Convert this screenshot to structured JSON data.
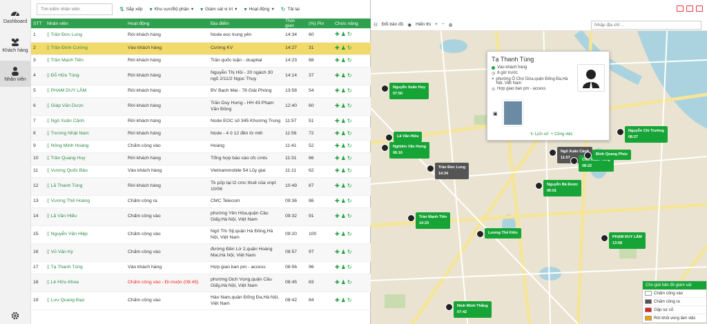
{
  "sidebar": {
    "items": [
      {
        "label": "Dashboard",
        "icon": "dashboard-icon"
      },
      {
        "label": "Khách hàng",
        "icon": "users-icon"
      },
      {
        "label": "Nhân viên",
        "icon": "user-icon"
      }
    ]
  },
  "toolbar": {
    "search_placeholder": "Tìm kiếm nhân viên",
    "sort": "Sắp xếp",
    "area": "Khu vực/Bộ phận",
    "supervise": "Giám sát vị trí",
    "activity": "Hoạt động",
    "reload": "Tải lại"
  },
  "table": {
    "headers": [
      "STT",
      "Nhân viên",
      "Hoạt động",
      "Địa điểm",
      "Thời gian",
      "(%) Pin",
      "Chức năng"
    ],
    "rows": [
      {
        "stt": "1",
        "name": "Trần Đức Long",
        "act": "Rời khách hàng",
        "place": "Node eoc trung yên",
        "time": "14:34",
        "pin": "60"
      },
      {
        "stt": "2",
        "name": "Trần Đình Cường",
        "act": "Vào khách hàng",
        "place": "Cường KV",
        "time": "14:27",
        "pin": "31"
      },
      {
        "stt": "3",
        "name": "Trần Mạnh Tiến",
        "act": "Rời khách hàng",
        "place": "Trần quốc luận - dcapital",
        "time": "14:23",
        "pin": "68"
      },
      {
        "stt": "4",
        "name": "Đỗ Hữu Tùng",
        "act": "Rời khách hàng",
        "place": "Nguyễn Thị Hồi - 20 ngách 30 ngõ 2/11/2 Ngọc Thụy",
        "time": "14:14",
        "pin": "37"
      },
      {
        "stt": "5",
        "name": "PHẠM DUY LÂM",
        "act": "Rời khách hàng",
        "place": "BV Bạch Mai - 78 Giải Phóng",
        "time": "13:58",
        "pin": "54"
      },
      {
        "stt": "6",
        "name": "Giáp Văn Dược",
        "act": "Rời khách hàng",
        "place": "Trần Duy Hưng - HH 43 Phạm Văn Đồng",
        "time": "12:40",
        "pin": "60"
      },
      {
        "stt": "7",
        "name": "Ngô Xuân Cảnh",
        "act": "Rời khách hàng",
        "place": "Node EOC số 345 Khương Trung",
        "time": "11:57",
        "pin": "51"
      },
      {
        "stt": "8",
        "name": "Trương Nhật Nam",
        "act": "Rời khách hàng",
        "place": "Node - 4 ô 12 đền lừ mth",
        "time": "11:56",
        "pin": "72"
      },
      {
        "stt": "9",
        "name": "Nông Minh Hoàng",
        "act": "Chấm công vào",
        "place": "Hoàng",
        "time": "11:41",
        "pin": "52"
      },
      {
        "stt": "10",
        "name": "Trần Quang Huy",
        "act": "Rời khách hàng",
        "place": "Tổng hợp báo cáo cfc cmts",
        "time": "11:31",
        "pin": "86"
      },
      {
        "stt": "11",
        "name": "Vương Quốc Bảo",
        "act": "Vào khách hàng",
        "place": "Vietnammobile 54 Lũy giai",
        "time": "11:11",
        "pin": "62"
      },
      {
        "stt": "12",
        "name": "Lã Thanh Tùng",
        "act": "Rời khách hàng",
        "place": "Tk p2p tại t2 cmc thuê của vnpt 10/06",
        "time": "10:49",
        "pin": "87"
      },
      {
        "stt": "13",
        "name": "Vương Thế Hoàng",
        "act": "Chấm công ra",
        "place": "CMC Telecom",
        "time": "09:36",
        "pin": "86"
      },
      {
        "stt": "14",
        "name": "Lã Văn Hiếu",
        "act": "Chấm công vào",
        "place": "phường Yên Hòa,quận Cầu Giấy,Hà Nội, Việt Nam",
        "time": "09:32",
        "pin": "91"
      },
      {
        "stt": "15",
        "name": "Nguyễn Văn Hiệp",
        "act": "Chấm công vào",
        "place": "Ngô Thì Sỹ,quận Hà Đông,Hà Nội, Việt Nam",
        "time": "09:20",
        "pin": "100"
      },
      {
        "stt": "16",
        "name": "Vũ Văn Kỳ",
        "act": "Chấm công vào",
        "place": "đường Đền Lừ 2,quận Hoàng Mai,Hà Nội, Việt Nam",
        "time": "08:57",
        "pin": "97"
      },
      {
        "stt": "17",
        "name": "Tạ Thanh Tùng",
        "act": "Vào khách hàng",
        "place": "Hợp giao ban pm - access",
        "time": "08:56",
        "pin": "96"
      },
      {
        "stt": "18",
        "name": "Lê Hữu Khoa",
        "act": "Chấm công vào - Đi muộn (08:45)",
        "place": "phường Dịch Vọng,quận Cầu Giấy,Hà Nội, Việt Nam",
        "time": "08:45",
        "pin": "83",
        "late": true
      },
      {
        "stt": "19",
        "name": "Lưu Quang Đạo",
        "act": "Chấm công vào",
        "place": "Hào Nam,quận Đống Đa,Hà Nội, Việt Nam",
        "time": "08:42",
        "pin": "84"
      }
    ]
  },
  "map": {
    "toolbar": {
      "layer": "Đổi bản đồ",
      "show": "Hiển thị",
      "search_placeholder": "Nhập địa chỉ ..."
    },
    "popup": {
      "name": "Tạ Thanh Tùng",
      "status": "Vào khách hàng",
      "ago": "6 giờ trước",
      "address": "phường Ô Chợ Dừa,quận Đống Đa,Hà Nội, Việt Nam",
      "task": "Hợp giao ban pm - access",
      "history": "Lịch sử",
      "work": "Công việc"
    },
    "markers": [
      {
        "name": "Nguyễn Xuân Huy",
        "time": "07:50"
      },
      {
        "name": "Lã Văn Hiếu",
        "time": ""
      },
      {
        "name": "Nghiêm Văn Hưng",
        "time": "06:16"
      },
      {
        "name": "Trần Đức Long",
        "time": "14:34"
      },
      {
        "name": "Ngô Xuân Cảnh",
        "time": "11:57"
      },
      {
        "name": "Chu Xuân Tùng",
        "time": "08:22"
      },
      {
        "name": "Đinh Quang Phúc",
        "time": ""
      },
      {
        "name": "Nguyễn Chí Trường",
        "time": "08:27"
      },
      {
        "name": "Nguyễn Bá Được",
        "time": "06:01"
      },
      {
        "name": "Trần Mạnh Tiến",
        "time": "14:23"
      },
      {
        "name": "Lương Thế Kiên",
        "time": ""
      },
      {
        "name": "PHẠM DUY LÂM",
        "time": "13:58"
      },
      {
        "name": "Ninh Minh Thắng",
        "time": "07:42"
      }
    ],
    "legend": {
      "title": "Chú giải bản đồ giám sát",
      "items": [
        {
          "label": "Chấm công vào",
          "color": "#ffffff"
        },
        {
          "label": "Chấm công ra",
          "color": "#555555"
        },
        {
          "label": "Gặp sự cố",
          "color": "#e02020"
        },
        {
          "label": "Rời khỏi vùng làm việc",
          "color": "#f0a000"
        }
      ]
    }
  }
}
